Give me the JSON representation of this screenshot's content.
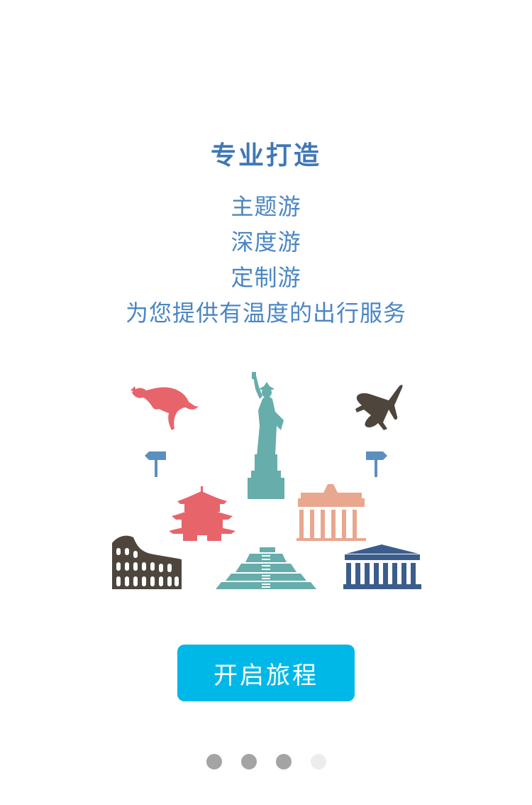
{
  "intro": {
    "title": "专业打造",
    "lines": [
      "主题游",
      "深度游",
      "定制游",
      "为您提供有温度的出行服务"
    ]
  },
  "illustration": {
    "items": [
      "kangaroo-icon",
      "airplane-icon",
      "statue-of-liberty-icon",
      "signpost-left-icon",
      "signpost-right-icon",
      "pagoda-icon",
      "brandenburg-gate-icon",
      "colosseum-icon",
      "pyramid-icon",
      "parthenon-icon"
    ],
    "colors": {
      "coral": "#e8646b",
      "teal": "#66adab",
      "brown": "#4e463c",
      "blue": "#5b8fbe",
      "peach": "#e8a78e",
      "navy": "#3b5d8c"
    }
  },
  "cta": {
    "label": "开启旅程",
    "color": "#00b8e8"
  },
  "pager": {
    "count": 4,
    "active_index": 3
  }
}
